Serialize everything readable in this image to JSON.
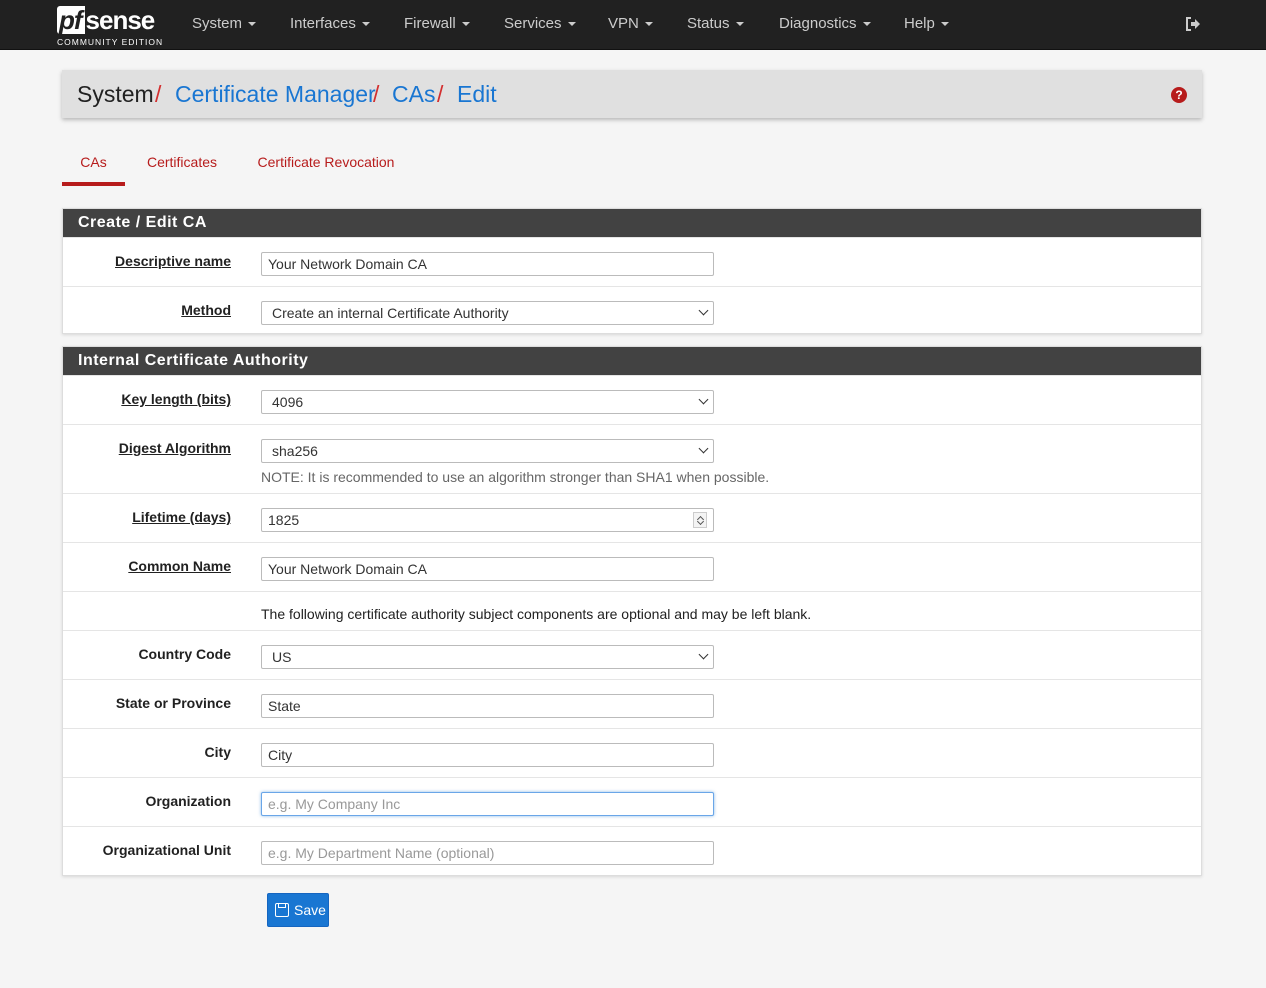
{
  "brand": {
    "logo_pf": "pf",
    "logo_sense": "sense",
    "edition": "COMMUNITY EDITION"
  },
  "nav": {
    "items": [
      {
        "label": "System"
      },
      {
        "label": "Interfaces"
      },
      {
        "label": "Firewall"
      },
      {
        "label": "Services"
      },
      {
        "label": "VPN"
      },
      {
        "label": "Status"
      },
      {
        "label": "Diagnostics"
      },
      {
        "label": "Help"
      }
    ]
  },
  "breadcrumb": {
    "items": [
      {
        "label": "System"
      },
      {
        "label": "Certificate Manager"
      },
      {
        "label": "CAs"
      },
      {
        "label": "Edit"
      }
    ],
    "separator": "/",
    "help": "?"
  },
  "tabs": [
    {
      "label": "CAs",
      "active": true
    },
    {
      "label": "Certificates"
    },
    {
      "label": "Certificate Revocation"
    }
  ],
  "panel1": {
    "title": "Create / Edit CA",
    "descriptive_name": {
      "label": "Descriptive name",
      "value": "Your Network Domain CA"
    },
    "method": {
      "label": "Method",
      "value": "Create an internal Certificate Authority"
    }
  },
  "panel2": {
    "title": "Internal Certificate Authority",
    "key_length": {
      "label": "Key length (bits)",
      "value": "4096"
    },
    "digest": {
      "label": "Digest Algorithm",
      "value": "sha256",
      "note": "NOTE: It is recommended to use an algorithm stronger than SHA1 when possible."
    },
    "lifetime": {
      "label": "Lifetime (days)",
      "value": "1825"
    },
    "common_name": {
      "label": "Common Name",
      "value": "Your Network Domain CA"
    },
    "optional_note": "The following certificate authority subject components are optional and may be left blank.",
    "country": {
      "label": "Country Code",
      "value": "US"
    },
    "state": {
      "label": "State or Province",
      "value": "State"
    },
    "city": {
      "label": "City",
      "value": "City"
    },
    "organization": {
      "label": "Organization",
      "placeholder": "e.g. My Company Inc"
    },
    "org_unit": {
      "label": "Organizational Unit",
      "placeholder": "e.g. My Department Name (optional)"
    }
  },
  "actions": {
    "save_label": "Save"
  }
}
